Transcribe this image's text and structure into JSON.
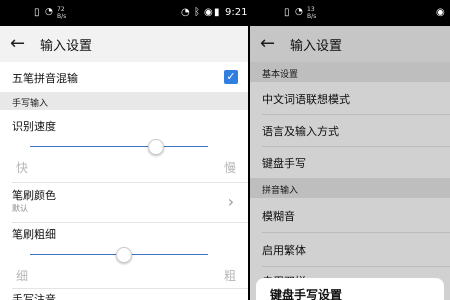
{
  "left": {
    "status": {
      "signal": "72",
      "speed": "B/s",
      "time": "9:21",
      "sim_icon": "sim-icon",
      "wifi_icon": "wifi-icon",
      "alarm_icon": "alarm-icon",
      "bluetooth_icon": "bluetooth-icon",
      "eye_icon": "eye-icon"
    },
    "title": "输入设置",
    "back_icon": "arrow-left-icon",
    "wubi_mix": {
      "label": "五笔拼音混输",
      "checked": true
    },
    "section_handwriting": "手写输入",
    "recognition_speed": {
      "label": "识别速度",
      "min_label": "快",
      "max_label": "慢",
      "value": 0.58
    },
    "brush_color": {
      "label": "笔刷颜色",
      "value": "默认"
    },
    "brush_thickness": {
      "label": "笔刷粗细",
      "min_label": "细",
      "max_label": "粗",
      "value": 0.58
    },
    "handwriting_note": {
      "label": "手写注音"
    },
    "accent_color": "#3b74c9"
  },
  "right": {
    "status": {
      "signal": "13",
      "speed": "B/s",
      "sim_icon": "sim-icon",
      "wifi_icon": "wifi-icon",
      "eye_icon": "eye-icon"
    },
    "title": "输入设置",
    "back_icon": "arrow-left-icon",
    "section_basic": "基本设置",
    "items_basic": [
      "中文词语联想模式",
      "语言及输入方式",
      "键盘手写"
    ],
    "section_pinyin": "拼音输入",
    "items_pinyin": [
      "模糊音",
      "启用繁体",
      "启用双拼"
    ],
    "sheet_title": "键盘手写设置"
  }
}
